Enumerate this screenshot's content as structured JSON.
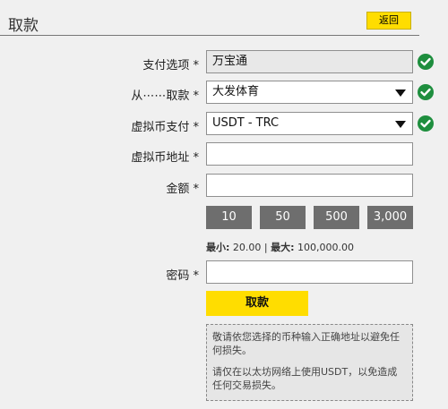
{
  "header": {
    "title": "取款",
    "back_label": "返回"
  },
  "form": {
    "payment_option": {
      "label": "支付选项 *",
      "value": "万宝通"
    },
    "from_wallet": {
      "label": "从⋯⋯取款 *",
      "value": "大发体育"
    },
    "crypto_payment": {
      "label": "虚拟币支付 *",
      "value": "USDT - TRC"
    },
    "crypto_address": {
      "label": "虚拟币地址 *",
      "value": ""
    },
    "amount": {
      "label": "金额 *",
      "value": ""
    },
    "quick_amounts": [
      "10",
      "50",
      "500",
      "3,000"
    ],
    "limits": {
      "min_label": "最小:",
      "min_value": "20.00",
      "separator": "|",
      "max_label": "最大:",
      "max_value": "100,000.00"
    },
    "password": {
      "label": "密码 *",
      "value": ""
    },
    "submit_label": "取款"
  },
  "notice": {
    "line1": "敬请依您选择的币种输入正确地址以避免任何损失。",
    "line2": "请仅在以太坊网络上使用USDT，以免造成任何交易损失。"
  },
  "colors": {
    "accent": "#ffdd00",
    "success": "#1e8e3e",
    "quick_button": "#6e6e6e"
  },
  "icons": {
    "valid": "check-circle-icon",
    "dropdown": "chevron-down-icon"
  }
}
